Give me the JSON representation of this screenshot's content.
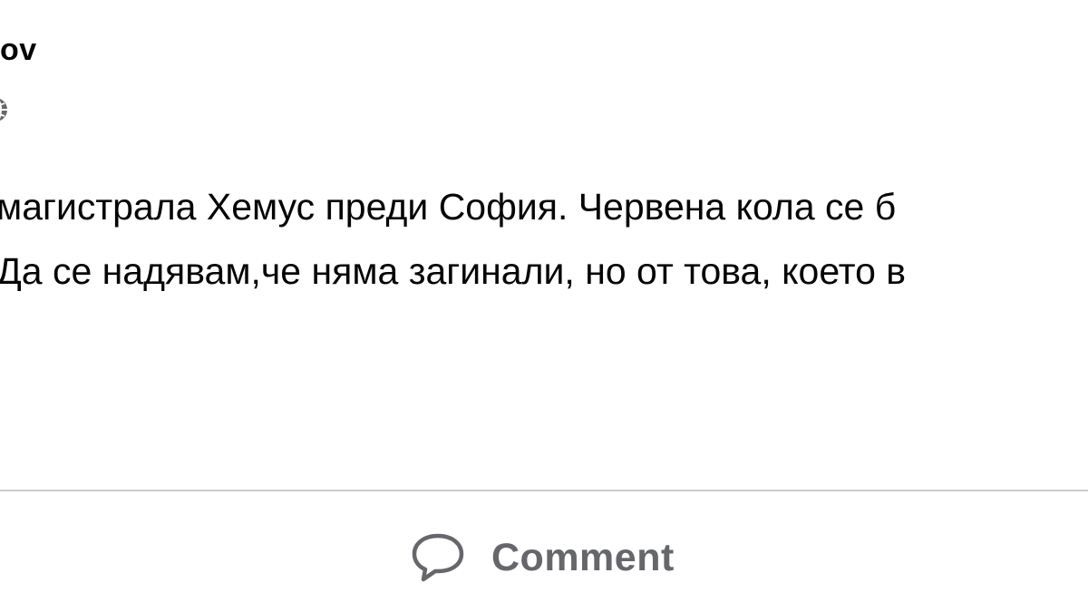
{
  "post": {
    "author_name": "ov",
    "text_lines": [
      "магистрала Хемус преди София. Червена кола се б",
      "Да се надявам,че няма загинали, но от това, което в"
    ]
  },
  "actions": {
    "comment_label": "Comment"
  },
  "icons": {
    "audience": "globe-icon",
    "comment": "comment-bubble-icon"
  },
  "colors": {
    "text": "#050505",
    "secondary_text": "#65676b",
    "divider": "#c9ccd1",
    "background": "#ffffff"
  }
}
